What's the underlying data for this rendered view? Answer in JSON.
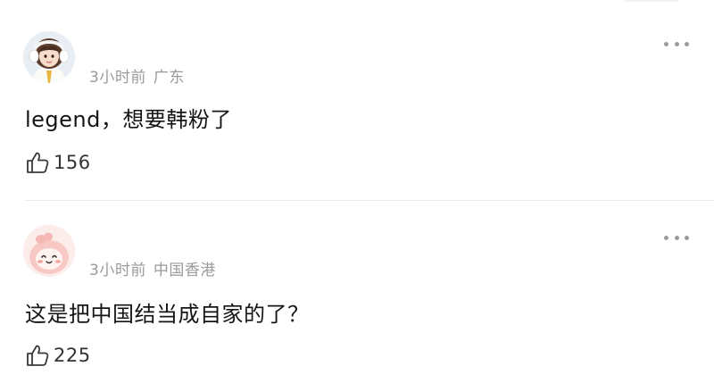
{
  "comments": [
    {
      "avatar": "user-avatar-girl-headphones",
      "time": "3小时前",
      "location": "广东",
      "text": "legend，想要韩粉了",
      "likes": "156"
    },
    {
      "avatar": "user-avatar-pink-cartoon",
      "time": "3小时前",
      "location": "中国香港",
      "text": "这是把中国结当成自家的了？",
      "likes": "225"
    }
  ],
  "icons": {
    "like": "thumbs-up-icon",
    "more": "more-dots-icon"
  },
  "colors": {
    "meta_text": "#9a9a9a",
    "body_text": "#151515",
    "divider": "#ececec"
  }
}
